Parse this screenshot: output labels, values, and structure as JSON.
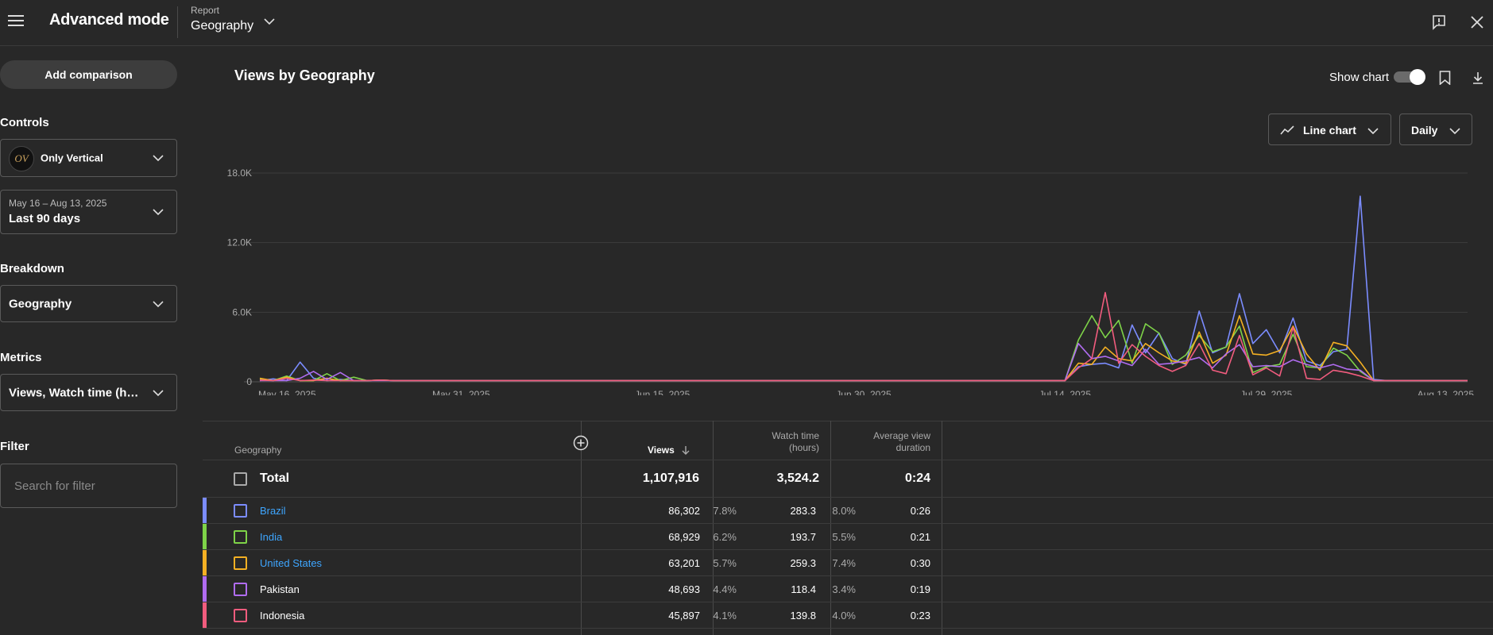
{
  "header": {
    "app_title": "Advanced mode",
    "report_label": "Report",
    "report_value": "Geography",
    "icons": [
      "hamburger-icon",
      "feedback-icon",
      "close-icon"
    ]
  },
  "sidebar": {
    "add_comparison": "Add comparison",
    "controls_heading": "Controls",
    "channel": {
      "name": "Only Vertical",
      "avatar_text": "OV"
    },
    "date_range": {
      "range": "May 16 – Aug 13, 2025",
      "label": "Last 90 days"
    },
    "breakdown_heading": "Breakdown",
    "breakdown_value": "Geography",
    "metrics_heading": "Metrics",
    "metrics_value": "Views, Watch time (hours), Average view duration",
    "filter_heading": "Filter",
    "filter_placeholder": "Search for filter"
  },
  "chart_header": {
    "title": "Views by Geography",
    "show_chart_label": "Show chart",
    "show_chart_on": true,
    "chart_type_label": "Line chart",
    "interval_label": "Daily"
  },
  "chart_data": {
    "type": "line",
    "x_tick_labels": [
      "May 16, 2025",
      "May 31, 2025",
      "Jun 15, 2025",
      "Jun 30, 2025",
      "Jul 14, 2025",
      "Jul 29, 2025",
      "Aug 13, 2025"
    ],
    "y_tick_labels": [
      "0",
      "6.0K",
      "12.0K",
      "18.0K"
    ],
    "ylim": [
      0,
      18000
    ],
    "grid": true,
    "series": [
      {
        "name": "Brazil",
        "color": "#7b8cff",
        "points": [
          [
            0,
            100
          ],
          [
            1,
            250
          ],
          [
            3,
            1700
          ],
          [
            4,
            300
          ],
          [
            6,
            200
          ],
          [
            9,
            150
          ],
          [
            60,
            100
          ],
          [
            61,
            1300
          ],
          [
            62,
            1500
          ],
          [
            63,
            1600
          ],
          [
            64,
            1200
          ],
          [
            65,
            4900
          ],
          [
            66,
            2500
          ],
          [
            67,
            4200
          ],
          [
            68,
            2000
          ],
          [
            69,
            1500
          ],
          [
            70,
            6100
          ],
          [
            71,
            2500
          ],
          [
            72,
            3000
          ],
          [
            73,
            7600
          ],
          [
            74,
            3300
          ],
          [
            75,
            4500
          ],
          [
            76,
            2500
          ],
          [
            77,
            5500
          ],
          [
            78,
            1800
          ],
          [
            79,
            1400
          ],
          [
            80,
            2600
          ],
          [
            81,
            2800
          ],
          [
            82,
            16000
          ],
          [
            83,
            200
          ]
        ]
      },
      {
        "name": "India",
        "color": "#7ed348",
        "points": [
          [
            0,
            200
          ],
          [
            2,
            500
          ],
          [
            5,
            700
          ],
          [
            7,
            400
          ],
          [
            9,
            150
          ],
          [
            60,
            100
          ],
          [
            61,
            3600
          ],
          [
            62,
            5700
          ],
          [
            63,
            3800
          ],
          [
            64,
            5300
          ],
          [
            65,
            1600
          ],
          [
            66,
            5000
          ],
          [
            67,
            4200
          ],
          [
            68,
            1500
          ],
          [
            69,
            2300
          ],
          [
            70,
            4000
          ],
          [
            71,
            2600
          ],
          [
            72,
            3000
          ],
          [
            73,
            4800
          ],
          [
            74,
            800
          ],
          [
            75,
            1300
          ],
          [
            76,
            1500
          ],
          [
            77,
            4100
          ],
          [
            78,
            1300
          ],
          [
            79,
            1200
          ],
          [
            80,
            2900
          ],
          [
            81,
            2300
          ],
          [
            82,
            900
          ],
          [
            83,
            100
          ]
        ]
      },
      {
        "name": "United States",
        "color": "#f4b023",
        "points": [
          [
            0,
            300
          ],
          [
            2,
            400
          ],
          [
            5,
            300
          ],
          [
            9,
            150
          ],
          [
            60,
            100
          ],
          [
            61,
            1600
          ],
          [
            62,
            1500
          ],
          [
            63,
            3000
          ],
          [
            64,
            2000
          ],
          [
            65,
            1800
          ],
          [
            66,
            3300
          ],
          [
            67,
            2500
          ],
          [
            68,
            1800
          ],
          [
            69,
            1600
          ],
          [
            70,
            4300
          ],
          [
            71,
            1600
          ],
          [
            72,
            2300
          ],
          [
            73,
            5700
          ],
          [
            74,
            2400
          ],
          [
            75,
            2300
          ],
          [
            76,
            2700
          ],
          [
            77,
            4800
          ],
          [
            78,
            2400
          ],
          [
            79,
            1000
          ],
          [
            80,
            3400
          ],
          [
            81,
            3100
          ],
          [
            82,
            1700
          ],
          [
            83,
            100
          ]
        ]
      },
      {
        "name": "Pakistan",
        "color": "#b06cf0",
        "points": [
          [
            0,
            100
          ],
          [
            3,
            300
          ],
          [
            4,
            900
          ],
          [
            5,
            200
          ],
          [
            6,
            800
          ],
          [
            8,
            100
          ],
          [
            60,
            100
          ],
          [
            61,
            3300
          ],
          [
            62,
            2000
          ],
          [
            63,
            2200
          ],
          [
            64,
            1800
          ],
          [
            65,
            1400
          ],
          [
            66,
            2800
          ],
          [
            67,
            1500
          ],
          [
            68,
            1600
          ],
          [
            69,
            1800
          ],
          [
            70,
            2100
          ],
          [
            71,
            1200
          ],
          [
            72,
            2400
          ],
          [
            73,
            3200
          ],
          [
            74,
            1300
          ],
          [
            75,
            1400
          ],
          [
            76,
            1300
          ],
          [
            77,
            1900
          ],
          [
            78,
            1500
          ],
          [
            79,
            1200
          ],
          [
            80,
            1500
          ],
          [
            81,
            1100
          ],
          [
            82,
            1000
          ],
          [
            83,
            100
          ]
        ]
      },
      {
        "name": "Indonesia",
        "color": "#f15c7e",
        "points": [
          [
            0,
            150
          ],
          [
            2,
            300
          ],
          [
            4,
            150
          ],
          [
            9,
            150
          ],
          [
            60,
            100
          ],
          [
            61,
            1200
          ],
          [
            62,
            2000
          ],
          [
            63,
            7700
          ],
          [
            64,
            1600
          ],
          [
            65,
            3200
          ],
          [
            66,
            2200
          ],
          [
            67,
            1400
          ],
          [
            68,
            900
          ],
          [
            69,
            1400
          ],
          [
            70,
            3300
          ],
          [
            71,
            1000
          ],
          [
            72,
            700
          ],
          [
            73,
            4000
          ],
          [
            74,
            600
          ],
          [
            75,
            1200
          ],
          [
            76,
            500
          ],
          [
            77,
            4700
          ],
          [
            78,
            300
          ],
          [
            79,
            200
          ],
          [
            80,
            1000
          ],
          [
            81,
            800
          ],
          [
            82,
            500
          ],
          [
            83,
            100
          ]
        ]
      }
    ]
  },
  "table": {
    "headers": {
      "geography": "Geography",
      "views": "Views",
      "watch_time_line1": "Watch time",
      "watch_time_line2": "(hours)",
      "avd_line1": "Average view",
      "avd_line2": "duration"
    },
    "total": {
      "label": "Total",
      "views": "1,107,916",
      "watch_time": "3,524.2",
      "avd": "0:24"
    },
    "rows": [
      {
        "country": "Brazil",
        "color": "#7b8cff",
        "is_link": true,
        "views": "86,302",
        "views_pct": "7.8%",
        "watch_time": "283.3",
        "watch_pct": "8.0%",
        "avd": "0:26"
      },
      {
        "country": "India",
        "color": "#7ed348",
        "is_link": true,
        "views": "68,929",
        "views_pct": "6.2%",
        "watch_time": "193.7",
        "watch_pct": "5.5%",
        "avd": "0:21"
      },
      {
        "country": "United States",
        "color": "#f4b023",
        "is_link": true,
        "views": "63,201",
        "views_pct": "5.7%",
        "watch_time": "259.3",
        "watch_pct": "7.4%",
        "avd": "0:30"
      },
      {
        "country": "Pakistan",
        "color": "#b06cf0",
        "is_link": false,
        "views": "48,693",
        "views_pct": "4.4%",
        "watch_time": "118.4",
        "watch_pct": "3.4%",
        "avd": "0:19"
      },
      {
        "country": "Indonesia",
        "color": "#f15c7e",
        "is_link": false,
        "views": "45,897",
        "views_pct": "4.1%",
        "watch_time": "139.8",
        "watch_pct": "4.0%",
        "avd": "0:23"
      }
    ]
  }
}
